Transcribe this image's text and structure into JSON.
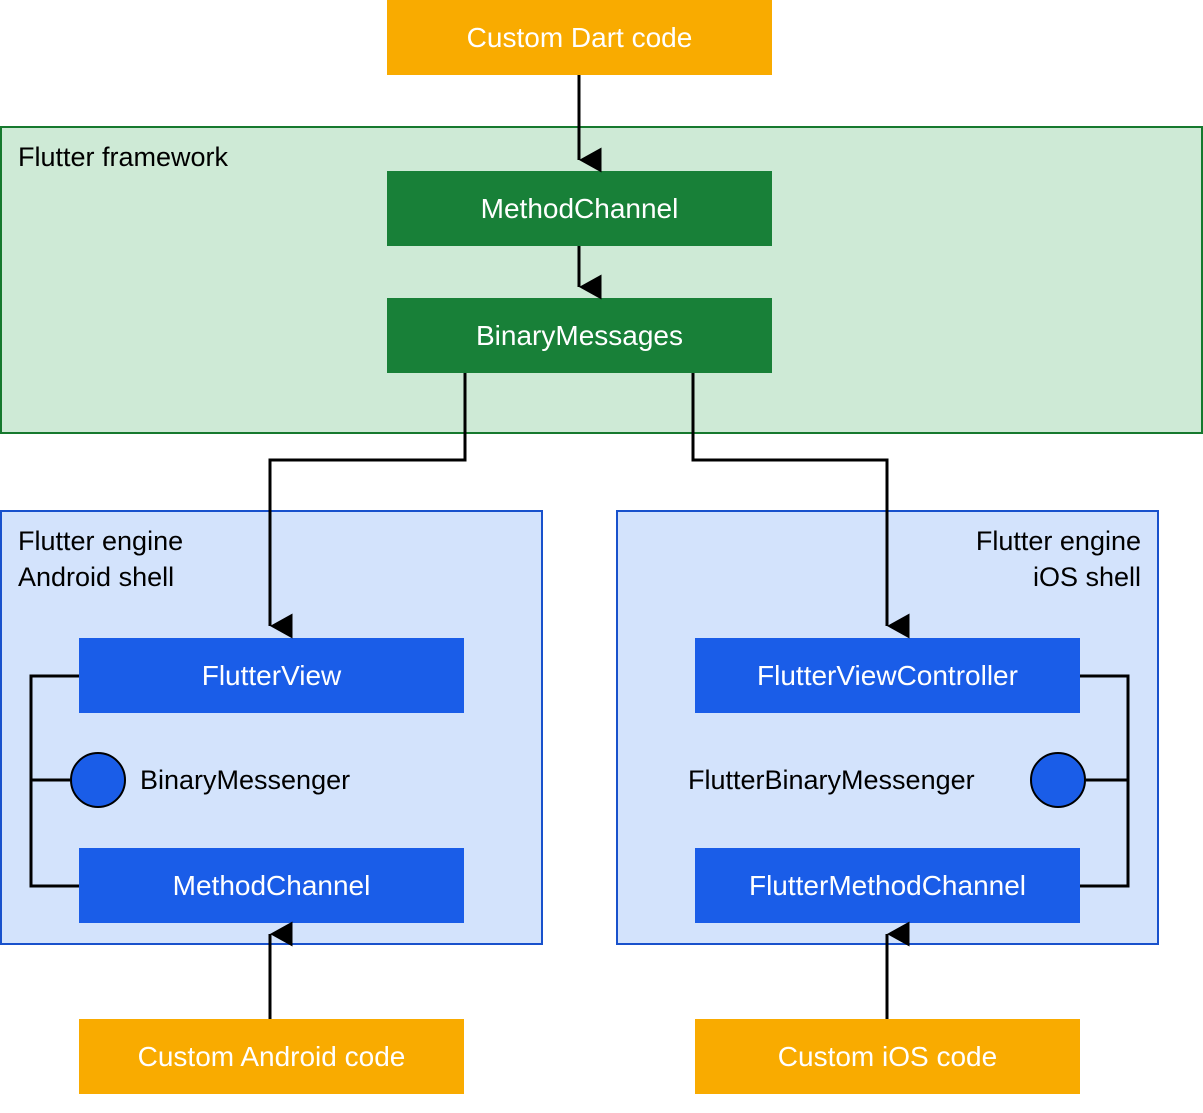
{
  "custom_dart": "Custom Dart code",
  "framework": {
    "title": "Flutter framework",
    "method_channel": "MethodChannel",
    "binary_messages": "BinaryMessages"
  },
  "android": {
    "title_line1": "Flutter engine",
    "title_line2": "Android shell",
    "flutter_view": "FlutterView",
    "binary_messenger": "BinaryMessenger",
    "method_channel": "MethodChannel",
    "custom_code": "Custom Android code"
  },
  "ios": {
    "title_line1": "Flutter engine",
    "title_line2": "iOS shell",
    "flutter_view_controller": "FlutterViewController",
    "flutter_binary_messenger": "FlutterBinaryMessenger",
    "flutter_method_channel": "FlutterMethodChannel",
    "custom_code": "Custom iOS code"
  }
}
